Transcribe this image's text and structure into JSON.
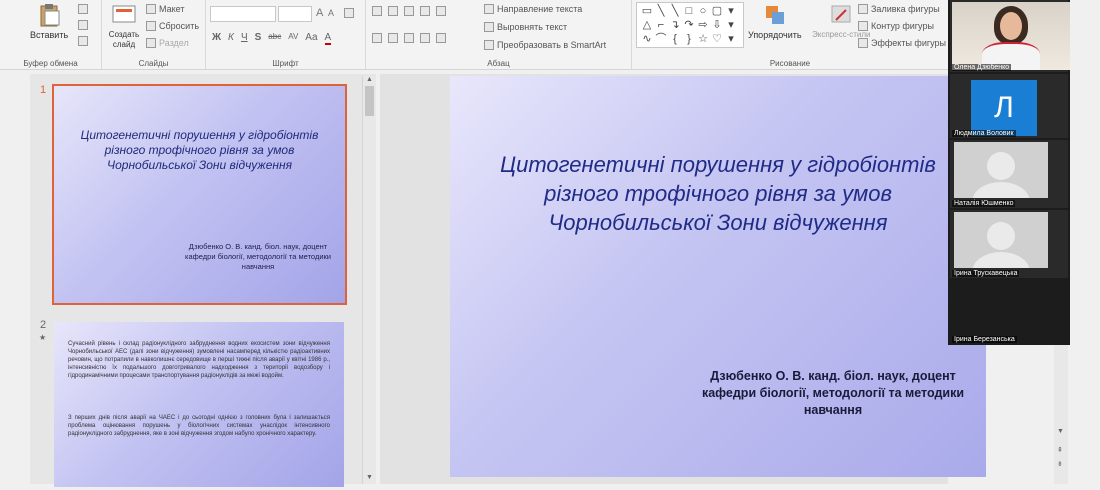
{
  "ribbon": {
    "clipboard": {
      "paste_label": "Вставить",
      "group_label": "Буфер обмена"
    },
    "slides": {
      "create_label": "Создать слайд",
      "layout_label": "Макет",
      "reset_label": "Сбросить",
      "section_label": "Раздел",
      "group_label": "Слайды"
    },
    "font": {
      "font_name": "",
      "font_size": "",
      "bold": "Ж",
      "italic": "К",
      "underline": "Ч",
      "shadow": "S",
      "strike": "abc",
      "spacing": "AV",
      "case": "Aa",
      "color": "A",
      "grow": "A",
      "shrink": "A",
      "group_label": "Шрифт"
    },
    "paragraph": {
      "text_direction": "Направление текста",
      "align_text": "Выровнять текст",
      "smartart": "Преобразовать в SmartArt",
      "group_label": "Абзац"
    },
    "drawing": {
      "arrange_label": "Упорядочить",
      "quick_styles_label": "Экспресс-стили",
      "shape_fill": "Заливка фигуры",
      "shape_outline": "Контур фигуры",
      "shape_effects": "Эффекты фигуры",
      "group_label": "Рисование"
    }
  },
  "thumbnails": {
    "slide1": {
      "number": "1",
      "title": "Цитогенетичні порушення у гідробіонтів різного трофічного рівня за умов Чорнобильської Зони відчуження",
      "author": "Дзюбенко О. В. канд. біол. наук, доцент кафедри біології, методології та методики навчання"
    },
    "slide2": {
      "number": "2",
      "star": "★",
      "p1": "Сучасний рівень і склад радіонуклідного забруднення водних екосистем зони відчуження Чорнобильської АЕС (далі зони відчуження) зумовлені насамперед кількістю радіоактивних речовин, що потрапили в навколишнє середовище в перші тижні після аварії у квітні 1986 р., інтенсивністю їх подальшого довготривалого надходження з території водозбору і гідродинамічними процесами транспортування радіонуклідів за межі водойм.",
      "p2": "З перших днів після аварії на ЧАЕС і до сьогодні однією з головних була і залишається проблема оцінювання порушень у біологічних системах унаслідок інтенсивного радіонуклідного забруднення, яке в зоні відчуження згодом набуло хронічного характеру."
    }
  },
  "main_slide": {
    "title": "Цитогенетичні порушення у гідробіонтів різного трофічного рівня за умов Чорнобильської Зони відчуження",
    "author": "Дзюбенко О. В. канд. біол. наук, доцент кафедри біології, методології та методики навчання"
  },
  "video_panel": {
    "participants": [
      {
        "name": "Олена Дзюбенко",
        "type": "video"
      },
      {
        "name": "Людмила Воловик",
        "type": "letter",
        "letter": "Л",
        "color": "#1a7fd4"
      },
      {
        "name": "Наталія Юшменко",
        "type": "placeholder"
      },
      {
        "name": "Ірина Трускавецька",
        "type": "placeholder"
      },
      {
        "name": "Ірина Березанська",
        "type": "label"
      }
    ]
  },
  "colors": {
    "accent_selected": "#e0623a",
    "slide_title": "#1f2b86",
    "letter_avatar": "#1a7fd4"
  }
}
